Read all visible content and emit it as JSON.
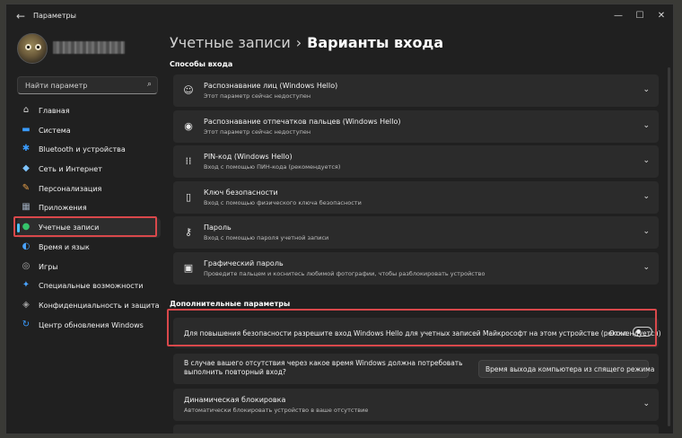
{
  "app": {
    "title": "Параметры"
  },
  "window_controls": {
    "minimize": "—",
    "maximize": "☐",
    "close": "✕"
  },
  "search": {
    "placeholder": "Найти параметр"
  },
  "sidebar": {
    "items": [
      {
        "label": "Главная",
        "icon": "home-icon",
        "glyph": "⌂",
        "color": "#d8d8d8"
      },
      {
        "label": "Система",
        "icon": "system-icon",
        "glyph": "▬",
        "color": "#3a9cff"
      },
      {
        "label": "Bluetooth и устройства",
        "icon": "bluetooth-icon",
        "glyph": "✱",
        "color": "#3a9cff"
      },
      {
        "label": "Сеть и Интернет",
        "icon": "network-icon",
        "glyph": "◆",
        "color": "#7fc4ff"
      },
      {
        "label": "Персонализация",
        "icon": "brush-icon",
        "glyph": "✎",
        "color": "#e8a04a"
      },
      {
        "label": "Приложения",
        "icon": "apps-icon",
        "glyph": "▦",
        "color": "#9aa7b8"
      },
      {
        "label": "Учетные записи",
        "icon": "account-icon",
        "glyph": "●",
        "color": "#35c46a"
      },
      {
        "label": "Время и язык",
        "icon": "time-language-icon",
        "glyph": "◐",
        "color": "#4aa3ff"
      },
      {
        "label": "Игры",
        "icon": "gaming-icon",
        "glyph": "◎",
        "color": "#b0b0b0"
      },
      {
        "label": "Специальные возможности",
        "icon": "accessibility-icon",
        "glyph": "✦",
        "color": "#4aa3ff"
      },
      {
        "label": "Конфиденциальность и защита",
        "icon": "shield-icon",
        "glyph": "◈",
        "color": "#a0a0a0"
      },
      {
        "label": "Центр обновления Windows",
        "icon": "update-icon",
        "glyph": "↻",
        "color": "#3a9cff"
      }
    ],
    "active_index": 6
  },
  "breadcrumb": {
    "parent": "Учетные записи",
    "separator": "›",
    "current": "Варианты входа"
  },
  "sign_in_section": {
    "title": "Способы входа",
    "items": [
      {
        "title": "Распознавание лиц (Windows Hello)",
        "subtitle": "Этот параметр сейчас недоступен",
        "icon": "face-icon",
        "glyph": "☺"
      },
      {
        "title": "Распознавание отпечатков пальцев (Windows Hello)",
        "subtitle": "Этот параметр сейчас недоступен",
        "icon": "fingerprint-icon",
        "glyph": "◉"
      },
      {
        "title": "PIN-код (Windows Hello)",
        "subtitle": "Вход с помощью ПИН-кода (рекомендуется)",
        "icon": "pin-keypad-icon",
        "glyph": "⁞⁞"
      },
      {
        "title": "Ключ безопасности",
        "subtitle": "Вход с помощью физического ключа безопасности",
        "icon": "security-key-icon",
        "glyph": "▯"
      },
      {
        "title": "Пароль",
        "subtitle": "Вход с помощью пароля учетной записи",
        "icon": "key-icon",
        "glyph": "⚷"
      },
      {
        "title": "Графический пароль",
        "subtitle": "Проведите пальцем и коснитесь любимой фотографии, чтобы разблокировать устройство",
        "icon": "picture-icon",
        "glyph": "▣"
      }
    ]
  },
  "additional_section": {
    "title": "Дополнительные параметры",
    "hello_only": {
      "label": "Для повышения безопасности разрешите вход Windows Hello для учетных записей Майкрософт на этом устройстве (рекомендуется)",
      "state": "Откл."
    },
    "away": {
      "label": "В случае вашего отсутствия через какое время Windows должна потребовать выполнить повторный вход?",
      "selected": "Время выхода компьютера из спящего режима"
    },
    "dynamic_lock": {
      "title": "Динамическая блокировка",
      "subtitle": "Автоматически блокировать устройство в ваше отсутствие"
    }
  },
  "chevron": "⌄",
  "colors": {
    "accent": "#4cc2ff",
    "highlight_frame": "#d9484b",
    "background": "#202020",
    "card": "#2b2b2b"
  }
}
